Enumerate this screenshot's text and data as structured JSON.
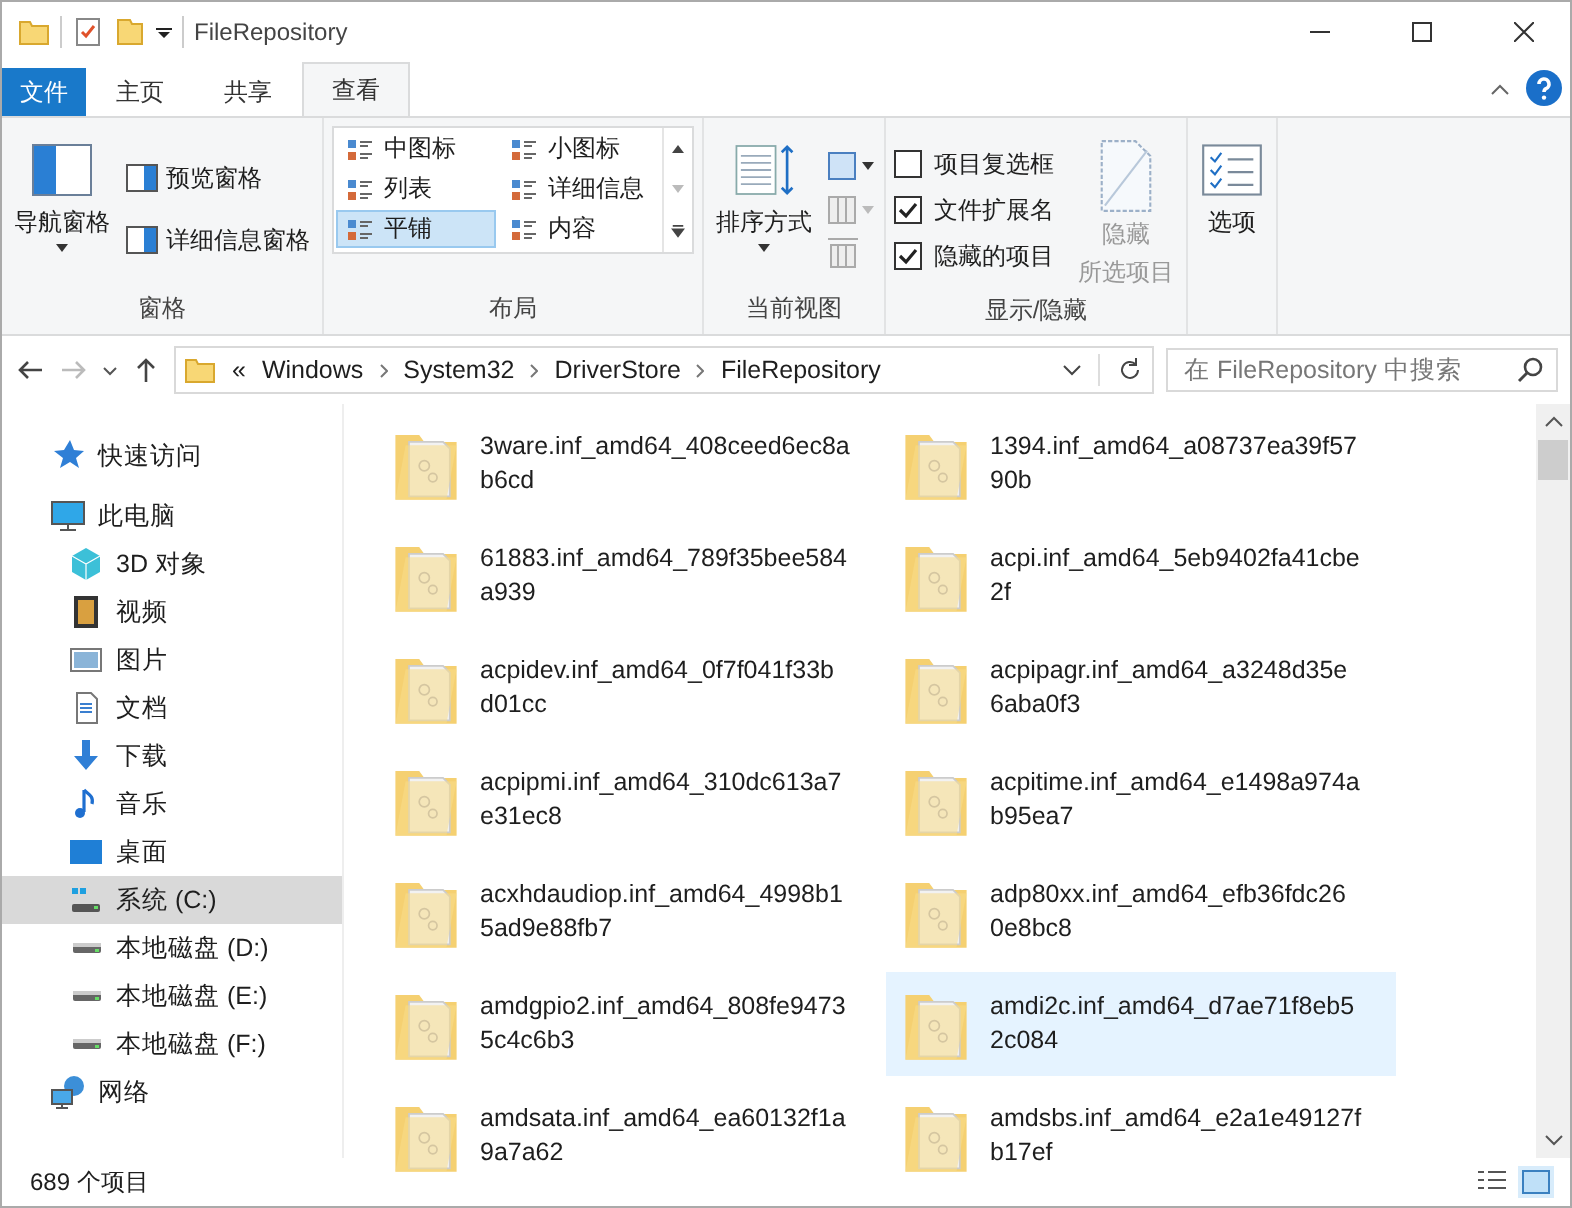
{
  "window": {
    "title": "FileRepository"
  },
  "ribbon_tabs": [
    {
      "label": "文件",
      "kind": "file",
      "selected": false
    },
    {
      "label": "主页",
      "kind": "tab",
      "selected": false
    },
    {
      "label": "共享",
      "kind": "tab",
      "selected": false
    },
    {
      "label": "查看",
      "kind": "tab",
      "selected": true
    }
  ],
  "ribbon": {
    "panes": {
      "label": "窗格",
      "nav": "导航窗格",
      "preview": "预览窗格",
      "details": "详细信息窗格"
    },
    "layout": {
      "label": "布局",
      "options": [
        {
          "label": "中图标",
          "selected": false
        },
        {
          "label": "小图标",
          "selected": false
        },
        {
          "label": "列表",
          "selected": false
        },
        {
          "label": "详细信息",
          "selected": false
        },
        {
          "label": "平铺",
          "selected": true
        },
        {
          "label": "内容",
          "selected": false
        }
      ]
    },
    "current_view": {
      "label": "当前视图",
      "sort": "排序方式"
    },
    "show_hide": {
      "label": "显示/隐藏",
      "checks": [
        {
          "label": "项目复选框",
          "checked": false
        },
        {
          "label": "文件扩展名",
          "checked": true
        },
        {
          "label": "隐藏的项目",
          "checked": true
        }
      ],
      "hide_lines": [
        "隐藏",
        "所选项目"
      ],
      "hide_disabled": true
    },
    "options": "选项"
  },
  "address": {
    "crumbs": [
      "«",
      "Windows",
      "System32",
      "DriverStore",
      "FileRepository"
    ],
    "search_placeholder": "在 FileRepository 中搜索",
    "forward_disabled": true
  },
  "sidebar": {
    "items": [
      {
        "label": "快速访问",
        "selected": false
      },
      {
        "label": "此电脑",
        "selected": false,
        "children": [
          {
            "label": "3D 对象",
            "selected": false
          },
          {
            "label": "视频",
            "selected": false
          },
          {
            "label": "图片",
            "selected": false
          },
          {
            "label": "文档",
            "selected": false
          },
          {
            "label": "下载",
            "selected": false
          },
          {
            "label": "音乐",
            "selected": false
          },
          {
            "label": "桌面",
            "selected": false
          },
          {
            "label": "系统 (C:)",
            "selected": true
          },
          {
            "label": "本地磁盘 (D:)",
            "selected": false
          },
          {
            "label": "本地磁盘 (E:)",
            "selected": false
          },
          {
            "label": "本地磁盘 (F:)",
            "selected": false
          }
        ]
      },
      {
        "label": "网络",
        "selected": false
      }
    ]
  },
  "files": [
    {
      "name_lines": [
        "3ware.inf_amd64_408ceed6ec8a",
        "b6cd"
      ],
      "selected": false
    },
    {
      "name_lines": [
        "1394.inf_amd64_a08737ea39f57",
        "90b"
      ],
      "selected": false
    },
    {
      "name_lines": [
        "61883.inf_amd64_789f35bee584",
        "a939"
      ],
      "selected": false
    },
    {
      "name_lines": [
        "acpi.inf_amd64_5eb9402fa41cbe",
        "2f"
      ],
      "selected": false
    },
    {
      "name_lines": [
        "acpidev.inf_amd64_0f7f041f33b",
        "d01cc"
      ],
      "selected": false
    },
    {
      "name_lines": [
        "acpipagr.inf_amd64_a3248d35e",
        "6aba0f3"
      ],
      "selected": false
    },
    {
      "name_lines": [
        "acpipmi.inf_amd64_310dc613a7",
        "e31ec8"
      ],
      "selected": false
    },
    {
      "name_lines": [
        "acpitime.inf_amd64_e1498a974a",
        "b95ea7"
      ],
      "selected": false
    },
    {
      "name_lines": [
        "acxhdaudiop.inf_amd64_4998b1",
        "5ad9e88fb7"
      ],
      "selected": false
    },
    {
      "name_lines": [
        "adp80xx.inf_amd64_efb36fdc26",
        "0e8bc8"
      ],
      "selected": false
    },
    {
      "name_lines": [
        "amdgpio2.inf_amd64_808fe9473",
        "5c4c6b3"
      ],
      "selected": false
    },
    {
      "name_lines": [
        "amdi2c.inf_amd64_d7ae71f8eb5",
        "2c084"
      ],
      "selected": true
    },
    {
      "name_lines": [
        "amdsata.inf_amd64_ea60132f1a",
        "9a7a62"
      ],
      "selected": false
    },
    {
      "name_lines": [
        "amdsbs.inf_amd64_e2a1e49127f",
        "b17ef"
      ],
      "selected": false
    }
  ],
  "status_bar": {
    "count": "689 个项目"
  }
}
